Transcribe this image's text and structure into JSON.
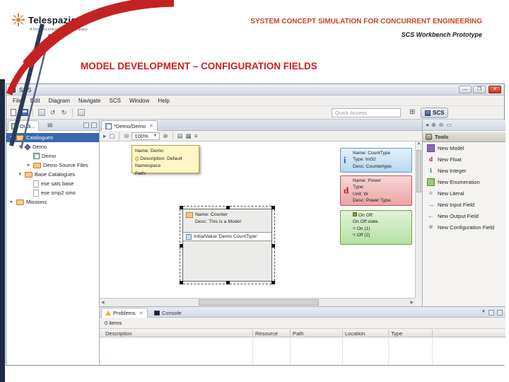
{
  "slide": {
    "header_title": "SYSTEM CONCEPT SIMULATION FOR CONCURRENT ENGINEERING",
    "header_subtitle": "SCS Workbench Prototype",
    "section_title": "MODEL DEVELOPMENT – CONFIGURATION FIELDS",
    "logo_text": "Telespazio",
    "logo_tagline": "A Finmeccanica/Thales Company",
    "colors": {
      "brand_red": "#c32222",
      "title_orange": "#c8431f",
      "section_red": "#d41b1b",
      "sidebar_navy": "#1d2a42",
      "selection_blue": "#3a67ad",
      "type_blue": "#b9d7f0",
      "type_red": "#eba4a4",
      "type_green": "#b6dfa2",
      "tooltip_yellow": "#fdf7c5"
    }
  },
  "window": {
    "title": "SCS",
    "controls": {
      "minimize": "—",
      "maximize": "❐",
      "close": "✕"
    },
    "menus": [
      "File",
      "Edit",
      "Diagram",
      "Navigate",
      "SCS",
      "Window",
      "Help"
    ],
    "quick_access_placeholder": "Quick Access",
    "perspective_label": "SCS"
  },
  "explorer": {
    "tab_label": "Outli...",
    "items": [
      {
        "label": "Catalogues",
        "indent": 0,
        "icon": "catalog-folder",
        "selected": true
      },
      {
        "label": "Demo",
        "indent": 1,
        "icon": "model"
      },
      {
        "label": "Demo",
        "indent": 2,
        "icon": "diagram-file"
      },
      {
        "label": "Demo Source Files",
        "indent": 2,
        "icon": "folder"
      },
      {
        "label": "Base Catalogues",
        "indent": 1,
        "icon": "folder"
      },
      {
        "label": "ese sats base",
        "indent": 2,
        "icon": "file"
      },
      {
        "label": "ese smp2 smo",
        "indent": 2,
        "icon": "file"
      },
      {
        "label": "Missions",
        "indent": 0,
        "icon": "folder"
      }
    ]
  },
  "editor": {
    "tab_label": "*Demo/Demo",
    "zoom_level": "100%",
    "tooltip": {
      "line1": "Name: Demo",
      "line2": "Description: Default Namespace",
      "line3": "Path:"
    },
    "counter_box": {
      "line1": "Name: Counter",
      "line2": "Desc: This is a Model",
      "field": "InitialValue 'Demo CountType'"
    },
    "count_type_box": {
      "glyph": "i",
      "line1": "Name: CountType",
      "line2": "Type: Int32",
      "line3": "Desc: Countertype."
    },
    "power_type_box": {
      "glyph": "d",
      "line1": "Name: Power",
      "line2": "Type:",
      "line3": "Unit: W",
      "line4": "Desc: Power Type."
    },
    "onoff_box": {
      "line1": "On Off:",
      "line2": "On Off state.",
      "item1": "On (1)",
      "item2": "Off (2)"
    }
  },
  "palette": {
    "drawer_label": "Tools",
    "items": [
      "New Model",
      "New Float",
      "New Integer",
      "New Enumeration",
      "New Literal",
      "New Input Field",
      "New Output Field",
      "New Configuration Field"
    ]
  },
  "problems": {
    "tab_problems": "Problems",
    "tab_console": "Console",
    "items_count": "0 items",
    "columns": [
      "Description",
      "Resource",
      "Path",
      "Location",
      "Type"
    ]
  }
}
